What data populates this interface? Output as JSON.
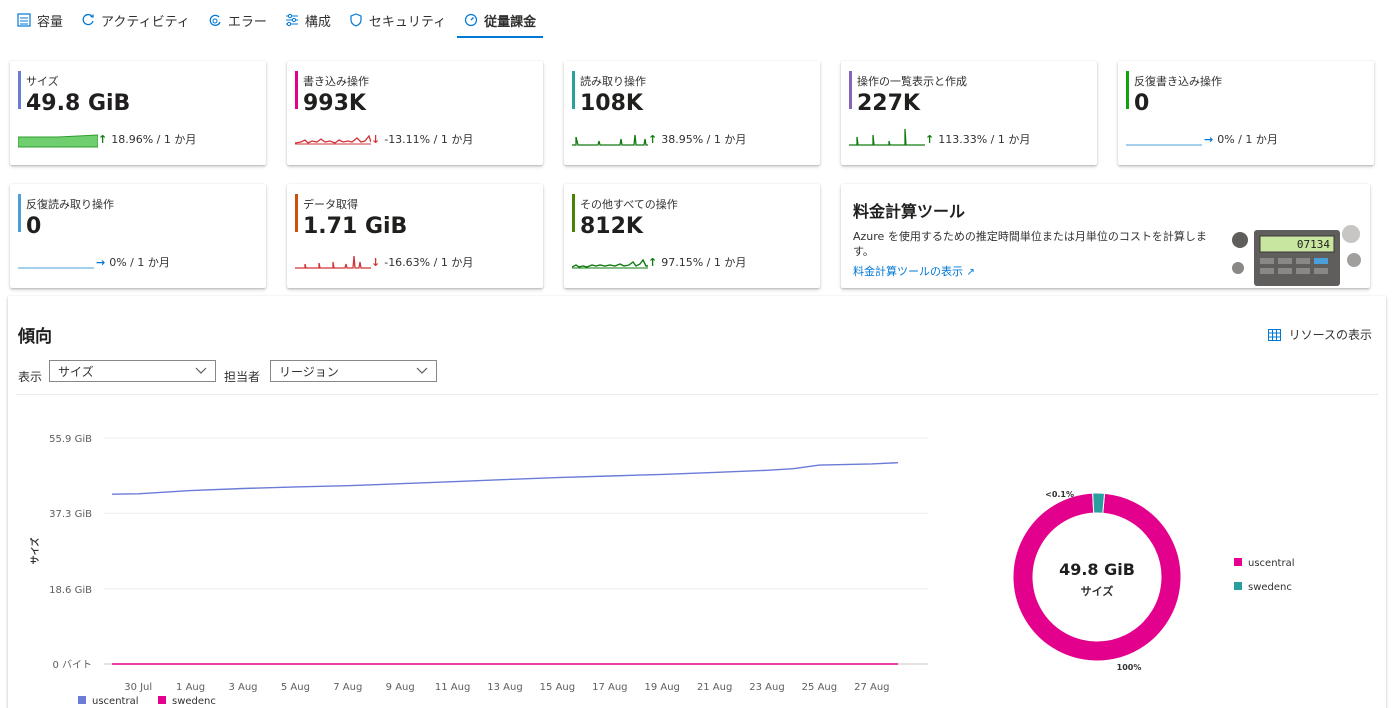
{
  "tabs": [
    {
      "label": "容量",
      "icon": "capacity-icon"
    },
    {
      "label": "アクティビティ",
      "icon": "activity-icon"
    },
    {
      "label": "エラー",
      "icon": "error-icon"
    },
    {
      "label": "構成",
      "icon": "config-icon"
    },
    {
      "label": "セキュリティ",
      "icon": "shield-icon"
    },
    {
      "label": "従量課金",
      "icon": "meter-icon",
      "active": true
    }
  ],
  "tiles": [
    {
      "label": "サイズ",
      "value": "49.8 GiB",
      "trend": "18.96% / 1 か月",
      "direction": "up",
      "color": "#6a7bd8"
    },
    {
      "label": "書き込み操作",
      "value": "993K",
      "trend": "-13.11% / 1 か月",
      "direction": "down",
      "color": "#e3008c"
    },
    {
      "label": "読み取り操作",
      "value": "108K",
      "trend": "38.95% / 1 か月",
      "direction": "up",
      "color": "#2a9fa0"
    },
    {
      "label": "操作の一覧表示と作成",
      "value": "227K",
      "trend": "113.33% / 1 か月",
      "direction": "up",
      "color": "#8764b8"
    },
    {
      "label": "反復書き込み操作",
      "value": "0",
      "trend": "0% / 1 か月",
      "direction": "flat",
      "color": "#13a10e"
    },
    {
      "label": "反復読み取り操作",
      "value": "0",
      "trend": "0% / 1 か月",
      "direction": "flat",
      "color": "#4a9fdb"
    },
    {
      "label": "データ取得",
      "value": "1.71 GiB",
      "trend": "-16.63% / 1 か月",
      "direction": "down",
      "color": "#ca5010"
    },
    {
      "label": "その他すべての操作",
      "value": "812K",
      "trend": "97.15% / 1 か月",
      "direction": "up",
      "color": "#498205"
    }
  ],
  "calculator": {
    "title": "料金計算ツール",
    "description": "Azure を使用するための推定時間単位または月単位のコストを計算します。",
    "link": "料金計算ツールの表示",
    "display": "07134"
  },
  "trend": {
    "title": "傾向",
    "view_resources": "リソースの表示",
    "show_label": "表示",
    "show_value": "サイズ",
    "by_label": "担当者",
    "by_value": "リージョン"
  },
  "colors": {
    "uscentral": "#6a7bd8",
    "swedenc": "#e3008c",
    "donut_pink": "#e3008c",
    "donut_teal": "#2a9fa0",
    "accent": "#0078d4"
  },
  "chart_data": [
    {
      "type": "line",
      "ylabel": "サイズ",
      "y_ticks": [
        "0 バイト",
        "18.6 GiB",
        "37.3 GiB",
        "55.9 GiB"
      ],
      "y_tick_values": [
        0,
        18.6,
        37.3,
        55.9
      ],
      "ylim": [
        0,
        55.9
      ],
      "x_ticks": [
        "30 Jul",
        "1 Aug",
        "3 Aug",
        "5 Aug",
        "7 Aug",
        "9 Aug",
        "11 Aug",
        "13 Aug",
        "15 Aug",
        "17 Aug",
        "19 Aug",
        "21 Aug",
        "23 Aug",
        "25 Aug",
        "27 Aug"
      ],
      "series": [
        {
          "name": "uscentral",
          "x": [
            "29 Jul",
            "30 Jul",
            "1 Aug",
            "3 Aug",
            "5 Aug",
            "7 Aug",
            "9 Aug",
            "11 Aug",
            "13 Aug",
            "15 Aug",
            "17 Aug",
            "19 Aug",
            "21 Aug",
            "23 Aug",
            "24 Aug",
            "25 Aug",
            "27 Aug",
            "28 Aug"
          ],
          "values": [
            42.0,
            42.1,
            42.9,
            43.4,
            43.8,
            44.1,
            44.6,
            45.1,
            45.6,
            46.1,
            46.5,
            46.9,
            47.4,
            47.9,
            48.3,
            49.2,
            49.5,
            49.8
          ]
        },
        {
          "name": "swedenc",
          "x": [
            "29 Jul",
            "28 Aug"
          ],
          "values": [
            0,
            0
          ]
        }
      ],
      "legend": "bottom-left"
    },
    {
      "type": "pie",
      "center_value": "49.8 GiB",
      "center_label": "サイズ",
      "slices": [
        {
          "name": "uscentral",
          "value": 99.95,
          "label": "100%"
        },
        {
          "name": "swedenc",
          "value": 2.3,
          "label": "<0.1%"
        }
      ],
      "legend": "right"
    }
  ]
}
